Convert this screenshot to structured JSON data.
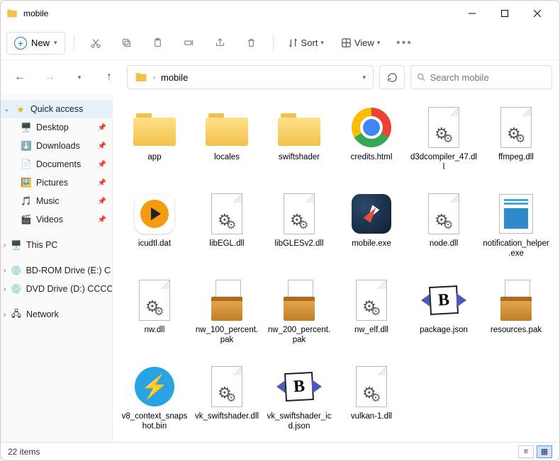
{
  "window": {
    "title": "mobile"
  },
  "toolbar": {
    "new_label": "New",
    "sort_label": "Sort",
    "view_label": "View"
  },
  "breadcrumb": {
    "segments": [
      "mobile"
    ],
    "chevron": "›"
  },
  "search": {
    "placeholder": "Search mobile"
  },
  "sidebar": {
    "quick_access": "Quick access",
    "items": [
      {
        "label": "Desktop",
        "icon": "desktop",
        "pinned": true
      },
      {
        "label": "Downloads",
        "icon": "download",
        "pinned": true
      },
      {
        "label": "Documents",
        "icon": "document",
        "pinned": true
      },
      {
        "label": "Pictures",
        "icon": "picture",
        "pinned": true
      },
      {
        "label": "Music",
        "icon": "music",
        "pinned": true
      },
      {
        "label": "Videos",
        "icon": "video",
        "pinned": true
      }
    ],
    "this_pc": "This PC",
    "bdrom": "BD-ROM Drive (E:) C",
    "dvd": "DVD Drive (D:) CCCO",
    "network": "Network"
  },
  "files": [
    {
      "name": "app",
      "icon": "folder"
    },
    {
      "name": "locales",
      "icon": "folder"
    },
    {
      "name": "swiftshader",
      "icon": "folder"
    },
    {
      "name": "credits.html",
      "icon": "chrome"
    },
    {
      "name": "d3dcompiler_47.dll",
      "icon": "dll"
    },
    {
      "name": "ffmpeg.dll",
      "icon": "dll"
    },
    {
      "name": "icudtl.dat",
      "icon": "play"
    },
    {
      "name": "libEGL.dll",
      "icon": "dll"
    },
    {
      "name": "libGLESv2.dll",
      "icon": "dll"
    },
    {
      "name": "mobile.exe",
      "icon": "safari"
    },
    {
      "name": "node.dll",
      "icon": "dll"
    },
    {
      "name": "notification_helper.exe",
      "icon": "notif"
    },
    {
      "name": "nw.dll",
      "icon": "dll"
    },
    {
      "name": "nw_100_percent.pak",
      "icon": "pak"
    },
    {
      "name": "nw_200_percent.pak",
      "icon": "pak"
    },
    {
      "name": "nw_elf.dll",
      "icon": "dll"
    },
    {
      "name": "package.json",
      "icon": "json"
    },
    {
      "name": "resources.pak",
      "icon": "pak"
    },
    {
      "name": "v8_context_snapshot.bin",
      "icon": "bolt"
    },
    {
      "name": "vk_swiftshader.dll",
      "icon": "dll"
    },
    {
      "name": "vk_swiftshader_icd.json",
      "icon": "json"
    },
    {
      "name": "vulkan-1.dll",
      "icon": "dll"
    }
  ],
  "status": {
    "item_count": "22 items"
  }
}
